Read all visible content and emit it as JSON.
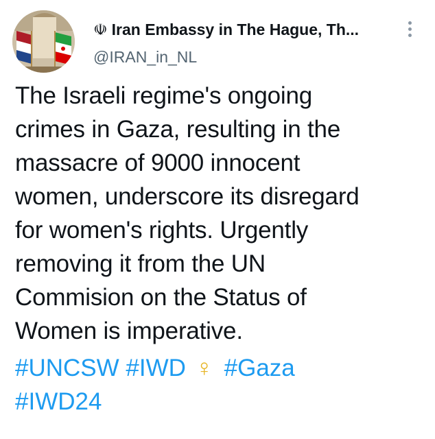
{
  "author": {
    "name_symbol": "☫",
    "display_name": "Iran Embassy in The Hague, Th...",
    "handle": "@IRAN_in_NL"
  },
  "menu": {
    "icon": "more-vertical-icon"
  },
  "tweet": {
    "lines": [
      "The Israeli regime's ongoing",
      "crimes in Gaza, resulting in the",
      "massacre of 9000 innocent",
      "women, underscore its disregard",
      "for women's rights. Urgently",
      "removing it from the UN",
      "Commision on the Status of",
      "Women is imperative."
    ],
    "hashtags": {
      "uncsw": "#UNCSW",
      "iwd": "#IWD",
      "female_sign": "♀",
      "gaza": "#Gaza",
      "iwd24": "#IWD24"
    }
  },
  "colors": {
    "text": "#0f1419",
    "secondary_text": "#536471",
    "link": "#1d9bf0",
    "female_sign": "#e6b422"
  }
}
